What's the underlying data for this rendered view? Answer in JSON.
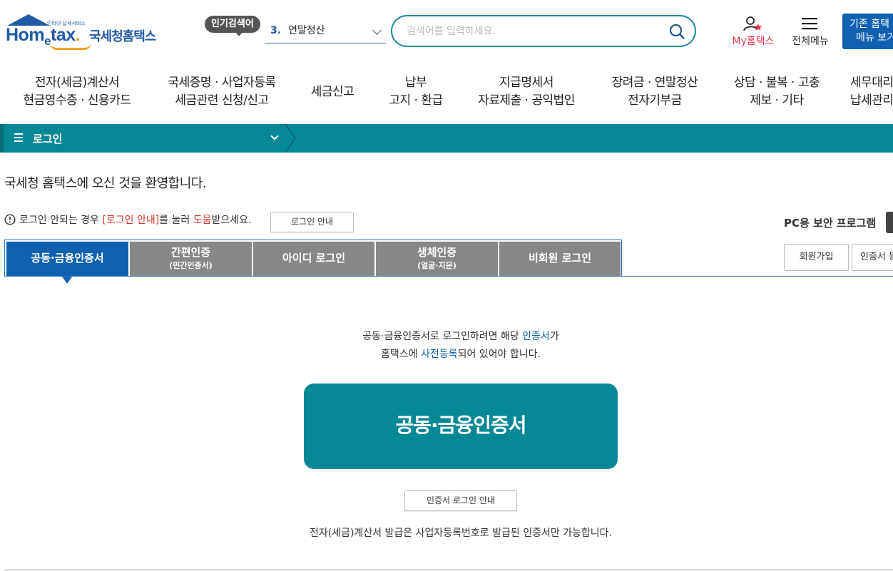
{
  "header": {
    "logo": {
      "home": "Hom",
      "e": "e",
      "tax": "tax",
      "dot": ".",
      "korean": "국세청홈택스",
      "tagline": "인터넷 납세서비스"
    },
    "popular": {
      "badge": "인기검색어",
      "rank": "3.",
      "term": "연말정산"
    },
    "search": {
      "placeholder": "검색어를 입력하세요."
    },
    "my_label": "My홈택스",
    "allmenu_label": "전체메뉴",
    "old_btn": {
      "line1": "기존 홈택",
      "line2": "메뉴 보기"
    }
  },
  "nav": [
    {
      "line1": "전자(세금)계산서",
      "line2": "현금영수증 · 신용카드"
    },
    {
      "line1": "국세증명 · 사업자등록",
      "line2": "세금관련 신청/신고"
    },
    {
      "line1": "세금신고",
      "line2": ""
    },
    {
      "line1": "납부",
      "line2": "고지 · 환급"
    },
    {
      "line1": "지급명세서",
      "line2": "자료제출 · 공익법인"
    },
    {
      "line1": "장려금 · 연말정산",
      "line2": "전자기부금"
    },
    {
      "line1": "상담 · 불복 · 고충",
      "line2": "제보 · 기타"
    },
    {
      "line1": "세무대리",
      "line2": "납세관리"
    }
  ],
  "login_bar": {
    "label": "로그인"
  },
  "welcome": "국세청 홈택스에 오신 것을 환영합니다.",
  "notice": {
    "pre": "로그인 안되는 경우 ",
    "link": "[로그인 안내]",
    "mid": "를 눌러 ",
    "help": "도움",
    "post": "받으세요."
  },
  "guide_btn": "로그인 안내",
  "pc_security": "PC용 보안 프로그램",
  "tabs": [
    {
      "label": "공동·금융인증서",
      "sub": ""
    },
    {
      "label": "간편인증",
      "sub": "(민간인증서)"
    },
    {
      "label": "아이디 로그인",
      "sub": ""
    },
    {
      "label": "생체인증",
      "sub": "(얼굴·지문)"
    },
    {
      "label": "비회원 로그인",
      "sub": ""
    }
  ],
  "side_buttons": {
    "join": "회원가입",
    "cert": "인증서 등"
  },
  "description": {
    "pre": "공동·금융인증서로 로그인하려면 해당 ",
    "cert": "인증서",
    "post1": "가",
    "pre2": "홈택스에 ",
    "reg": "사전등록",
    "post2": "되어 있어야 합니다."
  },
  "cert_button": "공동·금융인증서",
  "cert_guide_btn": "인증서 로그인 안내",
  "bottom_note": "전자(세금)계산서 발급은 사업자등록번호로 발급된 인증서만 가능합니다.",
  "colors": {
    "teal": "#058896",
    "blue": "#1061b0",
    "pink": "#e2334e",
    "orange": "#f0a020"
  }
}
